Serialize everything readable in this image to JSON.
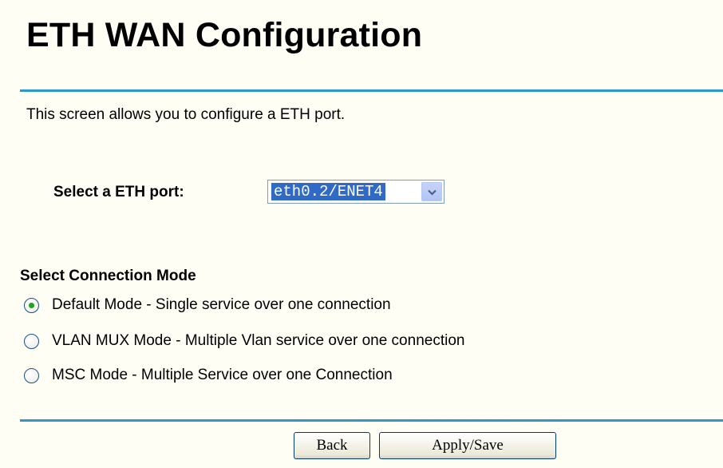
{
  "page": {
    "title": "ETH WAN Configuration",
    "description": "This screen allows you to configure a ETH port."
  },
  "port": {
    "label": "Select a ETH port:",
    "selected": "eth0.2/ENET4"
  },
  "connection_mode": {
    "heading": "Select Connection Mode",
    "options": [
      {
        "label": "Default Mode - Single service over one connection",
        "checked": true
      },
      {
        "label": "VLAN MUX Mode - Multiple Vlan service over one connection",
        "checked": false
      },
      {
        "label": "MSC Mode - Multiple Service over one Connection",
        "checked": false
      }
    ]
  },
  "buttons": {
    "back": "Back",
    "apply": "Apply/Save"
  },
  "colors": {
    "background": "#fffef4",
    "divider": "#2c97c8",
    "selection": "#316ac5",
    "radio_dot": "#21a121"
  },
  "icons": {
    "dropdown": "chevron-down-icon"
  }
}
